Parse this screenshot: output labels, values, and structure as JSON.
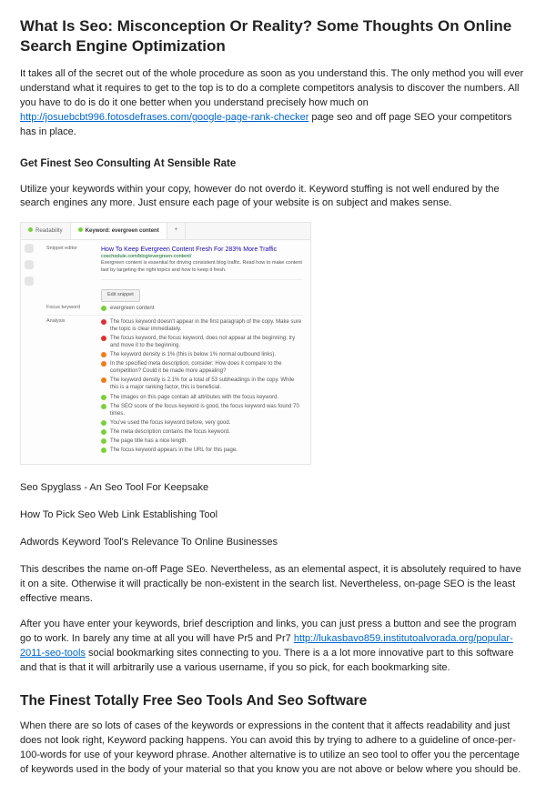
{
  "h1": "What Is Seo: Misconception Or Reality? Some Thoughts On Online Search Engine Optimization",
  "p1a": "It takes all of the secret out of the whole procedure as soon as you understand this. The only method you will ever understand what it requires to get to the top is to do a complete competitors analysis to discover the numbers. All you have to do is do it one better when you understand precisely how much on ",
  "link1": "http://josuebcbt996.fotosdefrases.com/google-page-rank-checker",
  "p1b": " page seo and off page SEO your competitors has in place.",
  "h3_1": "Get Finest Seo Consulting At Sensible Rate",
  "p2": "Utilize your keywords within your copy, however do not overdo it. Keyword stuffing is not well endured by the search engines any more. Just ensure each page of your website is on subject and makes sense.",
  "yoast": {
    "tab1": "Readability",
    "tab2": "Keyword: evergreen content",
    "tab3": "+",
    "snip_title": "How To Keep Evergreen Content Fresh For 283% More Traffic",
    "snip_url": "coschedule.com/blog/evergreen-content/",
    "snip_desc": "Evergreen content is essential for driving consistent blog traffic. Read how to make content last by targeting the right topics and how to keep it fresh.",
    "edit": "Edit snippet",
    "focus_label": "Focus keyword",
    "focus_kw": "evergreen content",
    "analysis_label": "Analysis",
    "items": [
      {
        "c": "r",
        "t": "The focus keyword doesn't appear in the first paragraph of the copy. Make sure the topic is clear immediately."
      },
      {
        "c": "r",
        "t": "The focus keyword, the focus keyword, does not appear at the beginning; try and move it to the beginning."
      },
      {
        "c": "o",
        "t": "The keyword density is 1% (this is below 1% normal outbound links)."
      },
      {
        "c": "o",
        "t": "In the specified meta description, consider: How does it compare to the competition? Could it be made more appealing?"
      },
      {
        "c": "o",
        "t": "The keyword density is 2.1% for a total of 53 subheadings in the copy. While this is a major ranking factor, this is beneficial."
      },
      {
        "c": "g",
        "t": "The images on this page contain alt attributes with the focus keyword."
      },
      {
        "c": "g",
        "t": "The SEO score of the focus keyword is good, the focus keyword was found 70 times."
      },
      {
        "c": "g",
        "t": "You've used the focus keyword before, very good."
      },
      {
        "c": "g",
        "t": "The meta description contains the focus keyword."
      },
      {
        "c": "g",
        "t": "The page title has a nice length."
      },
      {
        "c": "g",
        "t": "The focus keyword appears in the URL for this page."
      }
    ]
  },
  "sub1": "Seo Spyglass - An Seo Tool For Keepsake",
  "sub2": "How To Pick Seo Web Link Establishing Tool",
  "sub3": "Adwords Keyword Tool's Relevance To Online Businesses",
  "p3": "This describes the name on-off Page SEo. Nevertheless, as an elemental aspect, it is absolutely required to have it on a site. Otherwise it will practically be non-existent in the search list. Nevertheless, on-page SEO is the least effective means.",
  "p4a": "After you have enter your keywords, brief description and links, you can just press a button and see the program go to work. In barely any time at all you will have Pr5 and Pr7 ",
  "link2": "http://lukasbavo859.institutoalvorada.org/popular-2011-seo-tools",
  "p4b": " social bookmarking sites connecting to you. There is a a lot more innovative part to this software and that is that it will arbitrarily use a various username, if you so pick, for each bookmarking site.",
  "h2_1": "The Finest Totally Free Seo Tools And Seo Software",
  "p5": "When there are so lots of cases of the keywords or expressions in the content that it affects readability and just does not look right, Keyword packing happens. You can avoid this by trying to adhere to a guideline of once-per-100-words for use of your keyword phrase. Another alternative is to utilize an seo tool to offer you the percentage of keywords used in the body of your material so that you know you are not above or below where you should be."
}
